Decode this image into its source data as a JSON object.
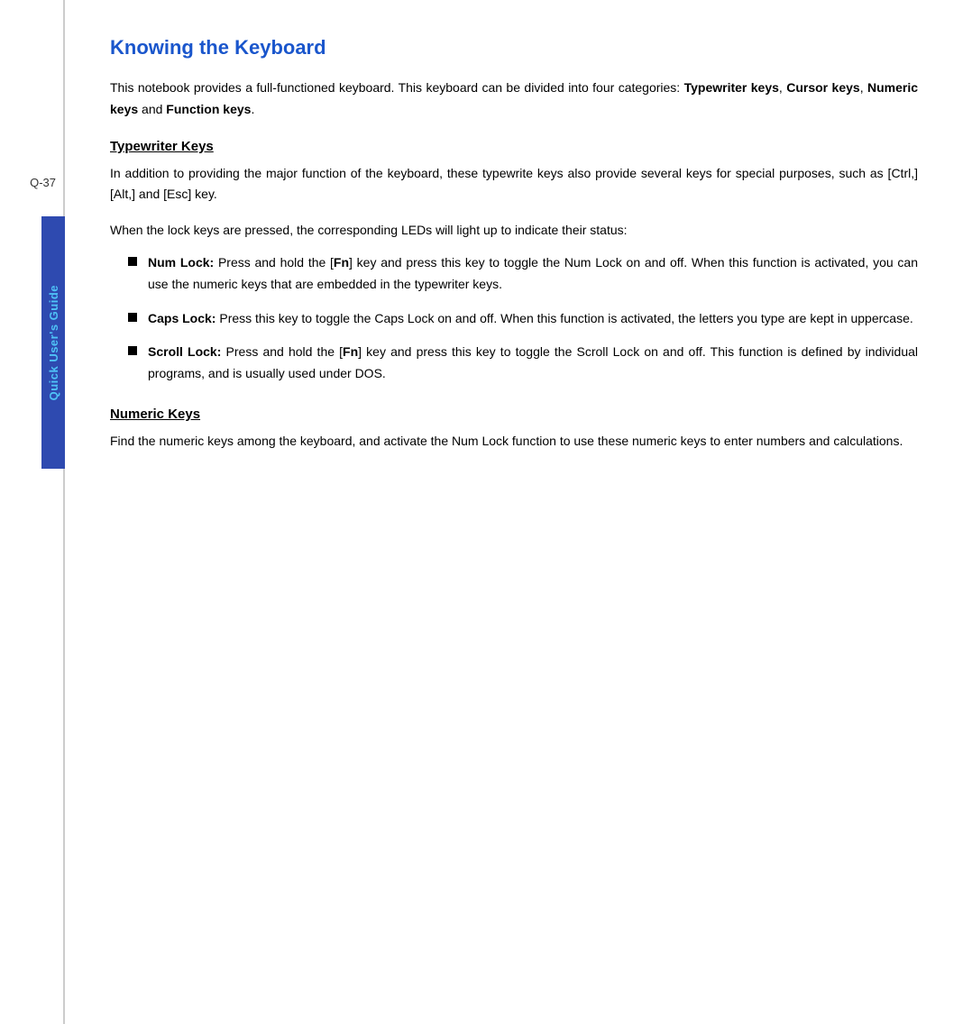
{
  "sidebar": {
    "page_number": "Q-37",
    "label": "Quick User's Guide"
  },
  "page": {
    "title": "Knowing the Keyboard",
    "intro": "This  notebook  provides  a  full-functioned  keyboard.   This  keyboard  can  be  divided  into  four categories: ",
    "intro_bold_1": "Typewriter keys",
    "intro_sep_1": ", ",
    "intro_bold_2": "Cursor keys",
    "intro_sep_2": ", ",
    "intro_bold_3": "Numeric keys",
    "intro_and": " and ",
    "intro_bold_4": "Function keys",
    "intro_end": ".",
    "typewriter_section": {
      "heading": "Typewriter Keys",
      "paragraph1": "In addition to providing the major function of the keyboard, these typewrite keys also provide several keys for special purposes, such as [",
      "ctrl": "Ctrl",
      "p1_mid": ",] [",
      "alt": "Alt",
      "p1_end": ",] and [",
      "esc": "Esc",
      "p1_close": "] key.",
      "lock_intro": "When the lock keys are pressed, the corresponding LEDs will light up to indicate their status:",
      "bullets": [
        {
          "label": "Num Lock:",
          "text": " Press and hold the [Fn] key and press this key to toggle the Num Lock on and off.  When  this  function  is  activated,  you  can  use  the  numeric  keys  that  are  embedded  in  the typewriter keys.",
          "fn_bold": "Fn"
        },
        {
          "label": "Caps Lock:",
          "text": " Press this key to toggle the Caps Lock on and off.   When this function is activated, the letters you type are kept in uppercase."
        },
        {
          "label": "Scroll Lock:",
          "text": " Press and hold the [",
          "fn": "Fn",
          "text2": "] key and press this key to toggle the Scroll Lock on and off.  This function is defined by individual programs, and is usually used under DOS."
        }
      ]
    },
    "numeric_section": {
      "heading": "Numeric Keys",
      "paragraph": "Find  the  numeric  keys  among  the  keyboard,  and  activate  the  Num  Lock  function  to  use  these numeric keys to enter numbers and calculations."
    }
  }
}
